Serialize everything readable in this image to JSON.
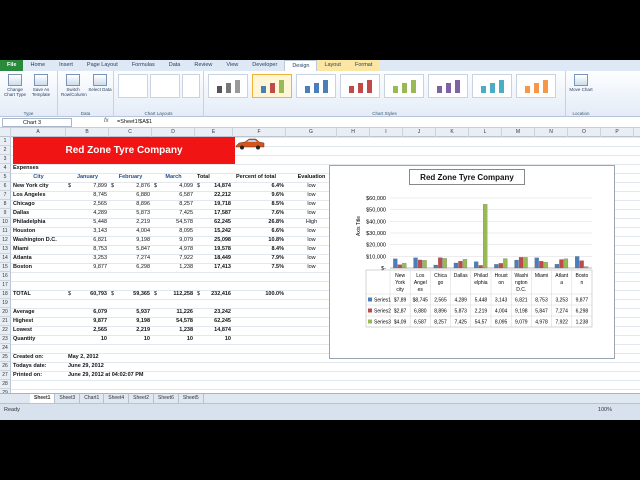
{
  "ribbon": {
    "tabs": [
      "File",
      "Home",
      "Insert",
      "Page Layout",
      "Formulas",
      "Data",
      "Review",
      "View",
      "Developer",
      "Design",
      "Layout",
      "Format"
    ],
    "active_tab": "Design",
    "groups": [
      {
        "label": "Type",
        "buttons": [
          "Change Chart Type",
          "Save As Template"
        ]
      },
      {
        "label": "Data",
        "buttons": [
          "Switch Row/Column",
          "Select Data"
        ]
      },
      {
        "label": "Chart Layouts"
      },
      {
        "label": "Chart Styles"
      },
      {
        "label": "Location",
        "buttons": [
          "Move Chart"
        ]
      }
    ]
  },
  "formula_bar": {
    "name_box": "Chart 3",
    "fx": "fx",
    "formula": "=Sheet1!$A$1"
  },
  "columns": [
    "A",
    "B",
    "C",
    "D",
    "E",
    "F",
    "G",
    "H",
    "I",
    "J",
    "K",
    "L",
    "M",
    "N",
    "O",
    "P"
  ],
  "rows": [
    "1",
    "2",
    "3",
    "4",
    "5",
    "6",
    "7",
    "8",
    "9",
    "10",
    "11",
    "12",
    "13",
    "14",
    "15",
    "16",
    "17",
    "18",
    "19",
    "20",
    "21",
    "22",
    "23",
    "24",
    "25",
    "26",
    "27",
    "28",
    "29"
  ],
  "sheet": {
    "title": "Red Zone Tyre Company",
    "expenses_label": "Expenses",
    "headers": {
      "city": "City",
      "january": "January",
      "february": "February",
      "march": "March",
      "total": "Total",
      "pct": "Percent of total",
      "evaluation": "Evaluation"
    },
    "data_rows": [
      {
        "city": "New York city",
        "jan_sym": "$",
        "jan": "7,899",
        "feb_sym": "$",
        "feb": "2,876",
        "mar_sym": "$",
        "mar": "4,099",
        "tot_sym": "$",
        "total": "14,874",
        "pct": "6.4%",
        "eval": "low"
      },
      {
        "city": "Los Angeles",
        "jan": "8,745",
        "feb": "6,880",
        "mar": "6,587",
        "total": "22,212",
        "pct": "9.6%",
        "eval": "low"
      },
      {
        "city": "Chicago",
        "jan": "2,565",
        "feb": "8,896",
        "mar": "8,257",
        "total": "19,718",
        "pct": "8.5%",
        "eval": "low"
      },
      {
        "city": "Dallas",
        "jan": "4,289",
        "feb": "5,873",
        "mar": "7,425",
        "total": "17,587",
        "pct": "7.6%",
        "eval": "low"
      },
      {
        "city": "Philadelphia",
        "jan": "5,448",
        "feb": "2,219",
        "mar": "54,578",
        "total": "62,245",
        "pct": "26.8%",
        "eval": "High"
      },
      {
        "city": "Houston",
        "jan": "3,143",
        "feb": "4,004",
        "mar": "8,095",
        "total": "15,242",
        "pct": "6.6%",
        "eval": "low"
      },
      {
        "city": "Washington D.C.",
        "jan": "6,821",
        "feb": "9,198",
        "mar": "9,079",
        "total": "25,098",
        "pct": "10.8%",
        "eval": "low"
      },
      {
        "city": "Miami",
        "jan": "8,753",
        "feb": "5,847",
        "mar": "4,978",
        "total": "19,578",
        "pct": "8.4%",
        "eval": "low"
      },
      {
        "city": "Atlanta",
        "jan": "3,253",
        "feb": "7,274",
        "mar": "7,922",
        "total": "18,449",
        "pct": "7.9%",
        "eval": "low"
      },
      {
        "city": "Boston",
        "jan": "9,877",
        "feb": "6,298",
        "mar": "1,238",
        "total": "17,413",
        "pct": "7.5%",
        "eval": "low"
      }
    ],
    "total_row": {
      "label": "TOTAL",
      "jan_sym": "$",
      "jan": "60,793",
      "feb_sym": "$",
      "feb": "59,365",
      "mar_sym": "$",
      "mar": "112,258",
      "tot_sym": "$",
      "total": "232,416",
      "pct": "100.0%"
    },
    "stats": [
      {
        "label": "Average",
        "jan": "6,079",
        "feb": "5,937",
        "mar": "11,226",
        "total": "23,242"
      },
      {
        "label": "Highest",
        "jan": "9,877",
        "feb": "9,198",
        "mar": "54,578",
        "total": "62,245"
      },
      {
        "label": "Lowest",
        "jan": "2,565",
        "feb": "2,219",
        "mar": "1,238",
        "total": "14,874"
      },
      {
        "label": "Quantity",
        "jan": "10",
        "feb": "10",
        "mar": "10",
        "total": "10"
      }
    ],
    "created_on_label": "Created on:",
    "created_on": "May 2, 2012",
    "todays_date_label": "Todays date:",
    "todays_date": "June 29, 2012",
    "printed_on_label": "Printed on:",
    "printed_on": "June 29, 2012 at 04:02:07 PM"
  },
  "chart_data": {
    "type": "bar",
    "title": "Red Zone Tyre Company",
    "ylabel": "Axis Title",
    "ylim": [
      0,
      60000
    ],
    "yticks": [
      "$60,000",
      "$50,000",
      "$40,000",
      "$30,000",
      "$20,000",
      "$10,000",
      "$-"
    ],
    "categories": [
      "New York city",
      "Los Angeles",
      "Chicago",
      "Dallas",
      "Philadelphia",
      "Houston",
      "Washington D.C.",
      "Miami",
      "Atlanta",
      "Boston"
    ],
    "category_labels": [
      [
        "New",
        "York",
        "city"
      ],
      [
        "Los",
        "Angel",
        "es"
      ],
      [
        "Chica",
        "go"
      ],
      [
        "Dallas"
      ],
      [
        "Philad",
        "elphia"
      ],
      [
        "Houst",
        "on"
      ],
      [
        "Washi",
        "ngton",
        "D.C."
      ],
      [
        "Miami"
      ],
      [
        "Atlant",
        "a"
      ],
      [
        "Bosto",
        "n"
      ]
    ],
    "series": [
      {
        "name": "Series1",
        "color": "#4a7ebb",
        "values": [
          7899,
          8745,
          2565,
          4289,
          5448,
          3143,
          6821,
          8753,
          3253,
          9877
        ],
        "labels": [
          "$7,89",
          "$8,745",
          "2,565",
          "4,289",
          "5,448",
          "3,143",
          "6,821",
          "8,753",
          "3,253",
          "9,877"
        ]
      },
      {
        "name": "Series2",
        "color": "#be4b48",
        "values": [
          2876,
          6880,
          8896,
          5873,
          2219,
          4004,
          9198,
          5847,
          7274,
          6298
        ],
        "labels": [
          "$2,87",
          "6,880",
          "8,896",
          "5,873",
          "2,219",
          "4,004",
          "9,198",
          "5,847",
          "7,274",
          "6,298"
        ]
      },
      {
        "name": "Series3",
        "color": "#98b954",
        "values": [
          4099,
          6587,
          8257,
          7425,
          54578,
          8095,
          9079,
          4978,
          7922,
          1238
        ],
        "labels": [
          "$4,09",
          "6,587",
          "8,257",
          "7,425",
          "54,57",
          "8,095",
          "9,079",
          "4,978",
          "7,922",
          "1,238"
        ]
      }
    ]
  },
  "sheet_tabs": [
    "Sheet1",
    "Sheet3",
    "Chart1",
    "Sheet4",
    "Sheet2",
    "Sheet6",
    "Sheet5"
  ],
  "active_sheet": "Sheet1",
  "status": {
    "ready": "Ready",
    "zoom": "100%"
  }
}
